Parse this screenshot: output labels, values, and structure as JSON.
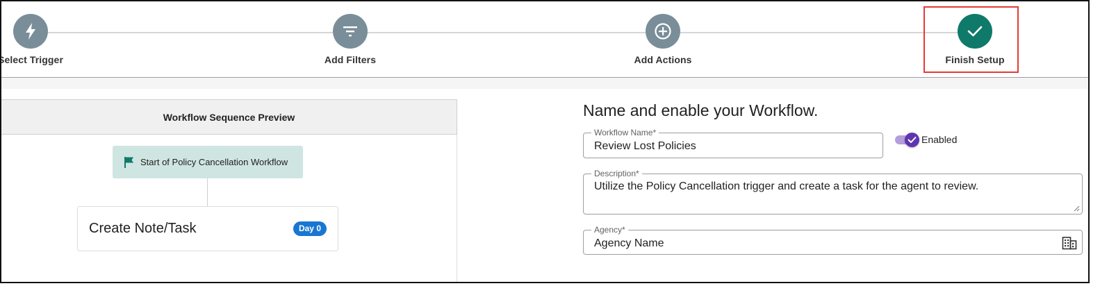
{
  "stepper": {
    "steps": [
      {
        "label": "Select Trigger",
        "icon": "lightning-bolt-icon",
        "completed": false
      },
      {
        "label": "Add Filters",
        "icon": "filter-icon",
        "completed": false
      },
      {
        "label": "Add Actions",
        "icon": "plus-circle-icon",
        "completed": false
      },
      {
        "label": "Finish Setup",
        "icon": "check-icon",
        "completed": true
      }
    ],
    "active_step": "Finish Setup"
  },
  "preview": {
    "header": "Workflow Sequence Preview",
    "start_node": {
      "label": "Start of Policy Cancellation Workflow",
      "icon": "flag-icon"
    },
    "action": {
      "title": "Create Note/Task",
      "badge": "Day 0"
    }
  },
  "form": {
    "title": "Name and enable your Workflow.",
    "workflow_name": {
      "label": "Workflow Name*",
      "value": "Review Lost Policies"
    },
    "enabled": {
      "label": "Enabled",
      "value": true
    },
    "description": {
      "label": "Description*",
      "value": "Utilize the Policy Cancellation trigger and create a task for the agent to review."
    },
    "agency": {
      "label": "Agency*",
      "value": "Agency Name",
      "icon": "building-icon"
    }
  },
  "colors": {
    "step_inactive": "#7a8e99",
    "step_complete": "#0f7a6a",
    "highlight": "#e53935",
    "start_node_bg": "#cfe5e1",
    "badge": "#1976d2",
    "toggle": "#5e35b1"
  }
}
